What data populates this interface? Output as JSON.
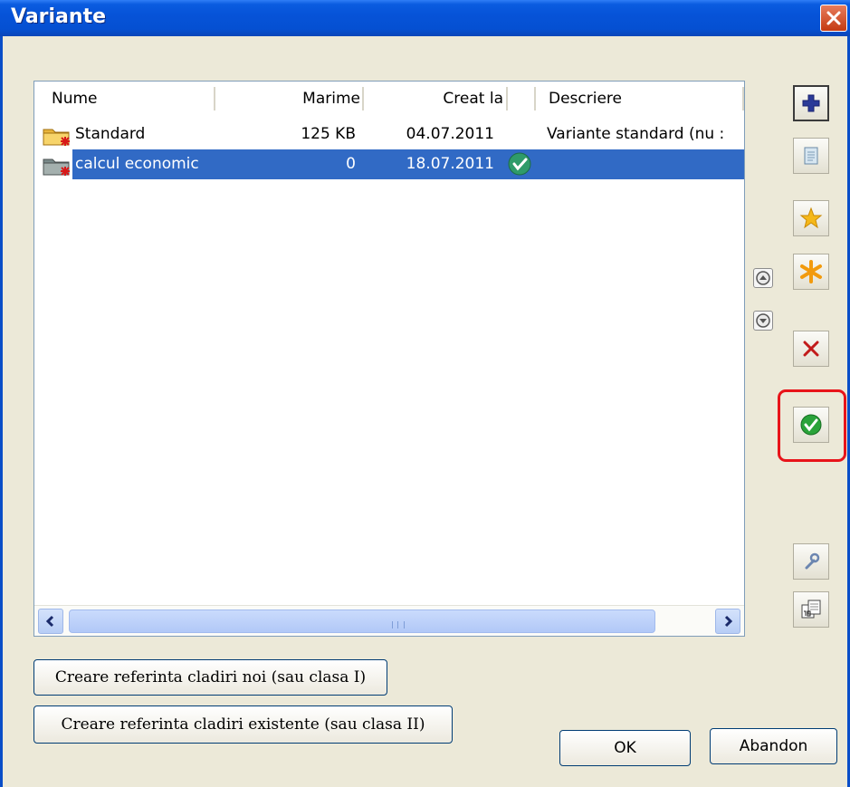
{
  "window": {
    "title": "Variante"
  },
  "list": {
    "columns": [
      "Nume",
      "Marime",
      "Creat la",
      "Descriere"
    ],
    "rows": [
      {
        "name": "Standard",
        "size": "125 KB",
        "created": "04.07.2011",
        "description": "Variante standard (nu :",
        "icon": "folder-icon",
        "active": false,
        "selected": false
      },
      {
        "name": "calcul economic",
        "size": "0",
        "created": "18.07.2011",
        "description": "",
        "icon": "folder-icon",
        "active": true,
        "selected": true
      }
    ]
  },
  "toolbar": {
    "icons": [
      "add-icon",
      "notepad-icon",
      "star-icon",
      "asterisk-icon",
      "delete-icon",
      "activate-check-icon",
      "wrench-icon",
      "calendar-icon",
      "move-up-icon",
      "move-down-icon"
    ]
  },
  "buttons": {
    "create_new": "Creare referinta cladiri noi (sau clasa I)",
    "create_existing": "Creare referinta cladiri existente (sau clasa II)",
    "ok": "OK",
    "cancel": "Abandon"
  },
  "colors": {
    "selection": "#316ac5",
    "highlight_ring": "#e8141a",
    "title_bar": "#0653d8"
  }
}
